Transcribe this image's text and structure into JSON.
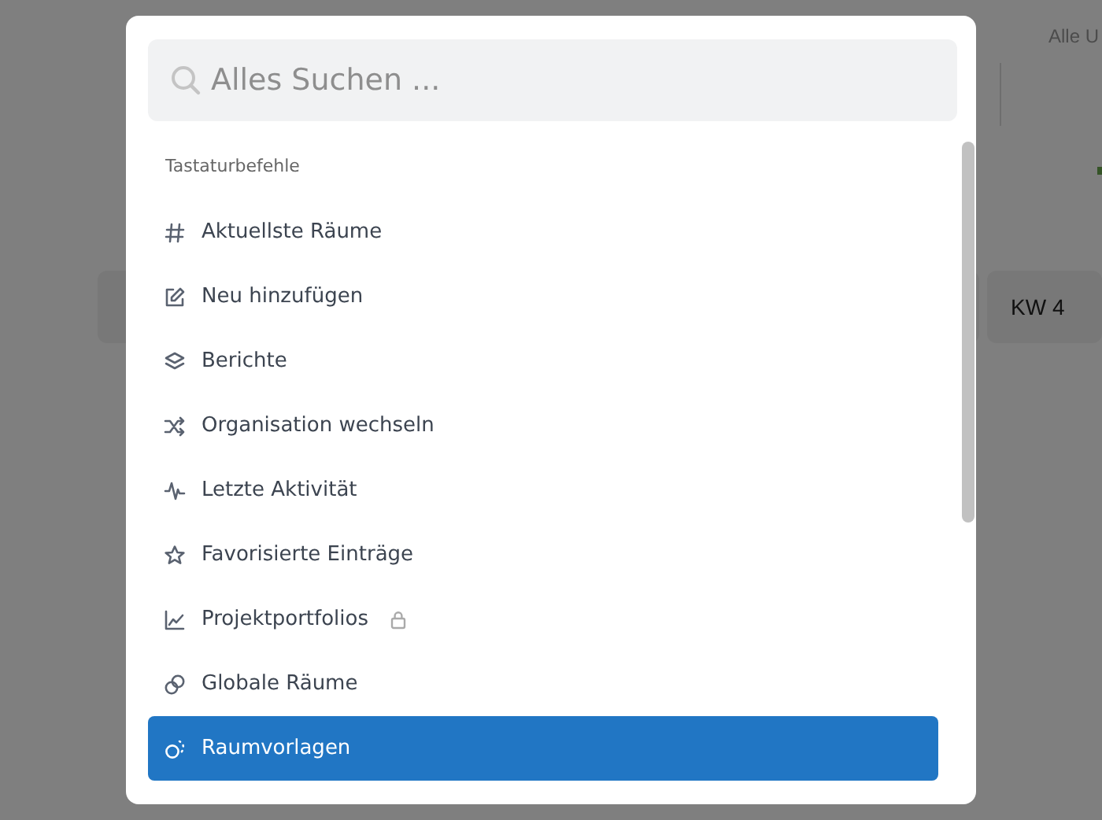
{
  "background": {
    "header_text": "Alle U",
    "week_card": "KW 4"
  },
  "command_palette": {
    "search": {
      "placeholder": "Alles Suchen ..."
    },
    "section_title": "Tastaturbefehle",
    "items": [
      {
        "label": "Aktuellste Räume",
        "selected": false,
        "locked": false
      },
      {
        "label": "Neu hinzufügen",
        "selected": false,
        "locked": false
      },
      {
        "label": "Berichte",
        "selected": false,
        "locked": false
      },
      {
        "label": "Organisation wechseln",
        "selected": false,
        "locked": false
      },
      {
        "label": "Letzte Aktivität",
        "selected": false,
        "locked": false
      },
      {
        "label": "Favorisierte Einträge",
        "selected": false,
        "locked": false
      },
      {
        "label": "Projektportfolios",
        "selected": false,
        "locked": true
      },
      {
        "label": "Globale Räume",
        "selected": false,
        "locked": false
      },
      {
        "label": "Raumvorlagen",
        "selected": true,
        "locked": false
      }
    ]
  }
}
